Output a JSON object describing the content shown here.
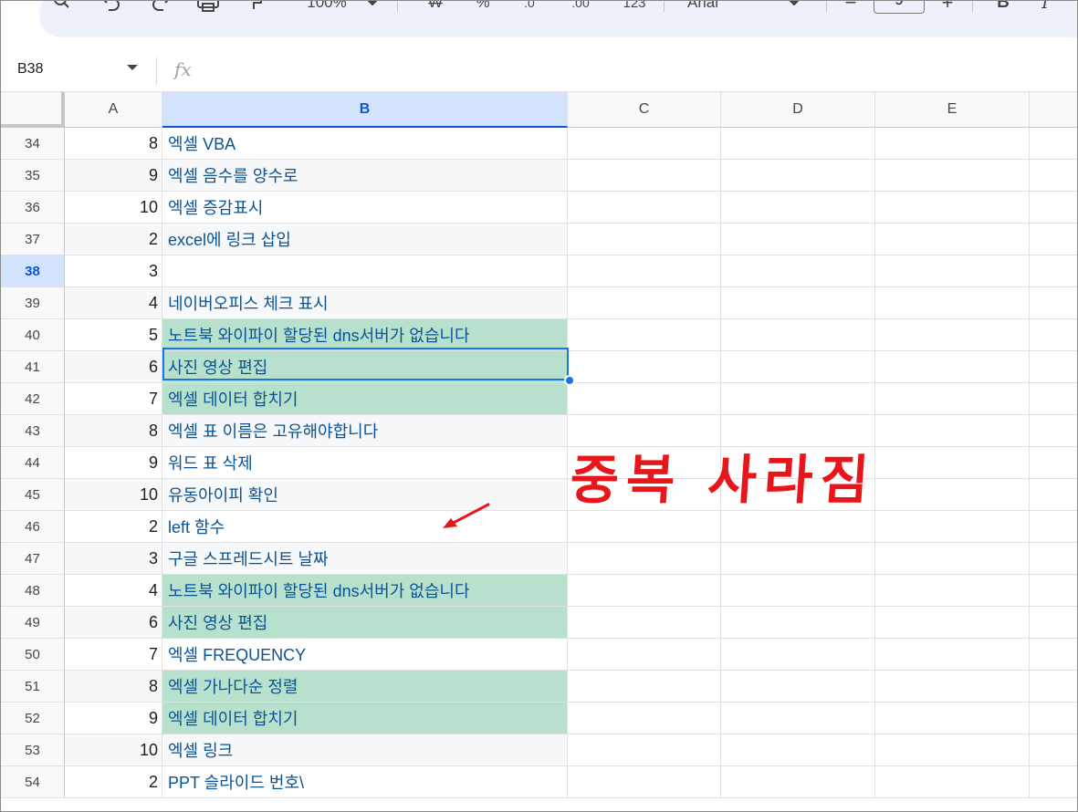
{
  "toolbar": {
    "zoom": "100%",
    "currency": "₩",
    "percent": "%",
    "dec_decrease": ".0",
    "dec_increase": ".00",
    "number_format": "123",
    "font": "Arial",
    "font_size_minus": "−",
    "font_size": "9",
    "font_size_plus": "+",
    "bold": "B",
    "italic": "I"
  },
  "formula_bar": {
    "name_box": "B38",
    "fx_label": "fx"
  },
  "columns": [
    "A",
    "B",
    "C",
    "D",
    "E"
  ],
  "selected_cell": "B38",
  "rows": [
    {
      "num": "34",
      "a": "8",
      "b": "엑셀 VBA",
      "dup": false
    },
    {
      "num": "35",
      "a": "9",
      "b": "엑셀 음수를 양수로",
      "dup": false
    },
    {
      "num": "36",
      "a": "10",
      "b": "엑셀 증감표시",
      "dup": false
    },
    {
      "num": "37",
      "a": "2",
      "b": "excel에 링크 삽입",
      "dup": false
    },
    {
      "num": "38",
      "a": "3",
      "b": "",
      "dup": false
    },
    {
      "num": "39",
      "a": "4",
      "b": "네이버오피스 체크 표시",
      "dup": false
    },
    {
      "num": "40",
      "a": "5",
      "b": "노트북 와이파이 할당된 dns서버가 없습니다",
      "dup": true
    },
    {
      "num": "41",
      "a": "6",
      "b": "사진 영상 편집",
      "dup": true
    },
    {
      "num": "42",
      "a": "7",
      "b": "엑셀 데이터 합치기",
      "dup": true
    },
    {
      "num": "43",
      "a": "8",
      "b": "엑셀 표 이름은 고유해야합니다",
      "dup": false
    },
    {
      "num": "44",
      "a": "9",
      "b": "워드 표 삭제",
      "dup": false
    },
    {
      "num": "45",
      "a": "10",
      "b": "유동아이피 확인",
      "dup": false
    },
    {
      "num": "46",
      "a": "2",
      "b": "left 함수",
      "dup": false
    },
    {
      "num": "47",
      "a": "3",
      "b": "구글 스프레드시트 날짜",
      "dup": false
    },
    {
      "num": "48",
      "a": "4",
      "b": "노트북 와이파이 할당된 dns서버가 없습니다",
      "dup": true
    },
    {
      "num": "49",
      "a": "6",
      "b": "사진 영상 편집",
      "dup": true
    },
    {
      "num": "50",
      "a": "7",
      "b": "엑셀 FREQUENCY",
      "dup": false
    },
    {
      "num": "51",
      "a": "8",
      "b": "엑셀 가나다순 정렬",
      "dup": true
    },
    {
      "num": "52",
      "a": "9",
      "b": "엑셀 데이터 합치기",
      "dup": true
    },
    {
      "num": "53",
      "a": "10",
      "b": "엑셀 링크",
      "dup": false
    },
    {
      "num": "54",
      "a": "2",
      "b": "PPT 슬라이드 번호\\",
      "dup": false
    }
  ],
  "annotation": {
    "text": "중복 사라짐",
    "color": "#e8151b"
  },
  "colors": {
    "duplicate_fill": "#b7e1cd",
    "selection": "#1a73e8",
    "cell_text": "#0b5394"
  }
}
